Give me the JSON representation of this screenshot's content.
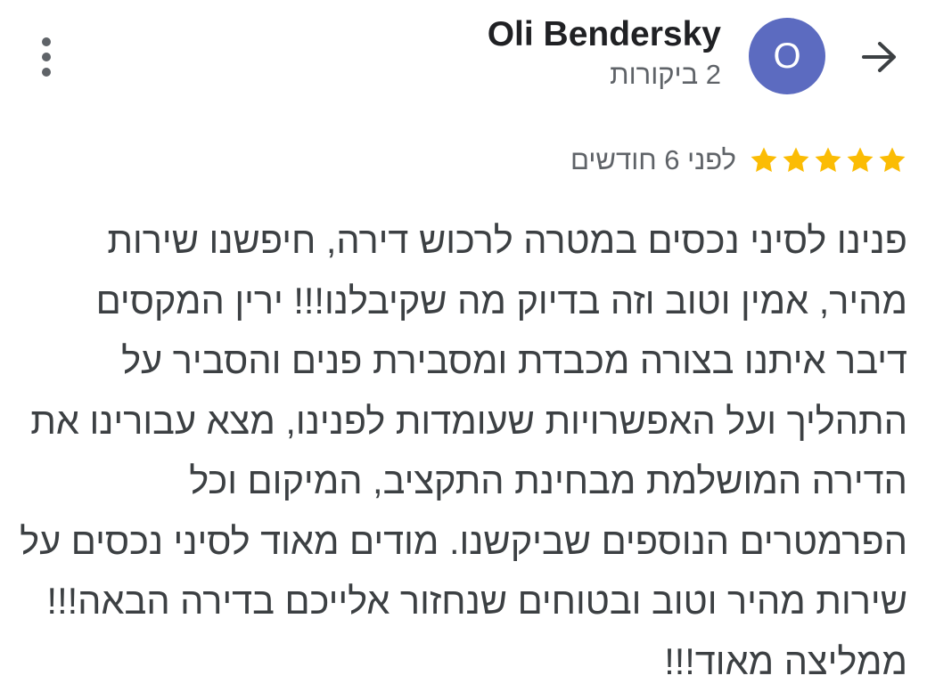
{
  "header": {
    "back_icon": "arrow-forward-icon",
    "avatar_letter": "O",
    "avatar_color": "#5c6bc0",
    "reviewer_name": "Oli Bendersky",
    "review_count": "2 ביקורות",
    "more_icon": "more-vert-icon"
  },
  "rating": {
    "stars": 5,
    "star_color": "#fbbc04",
    "time": "לפני 6 חודשים"
  },
  "review": {
    "text": "פנינו לסיני נכסים במטרה לרכוש דירה, חיפשנו שירות מהיר, אמין וטוב וזה בדיוק מה שקיבלנו!!! ירין המקסים דיבר איתנו בצורה מכבדת ומסבירת פנים והסביר על התהליך ועל האפשרויות שעומדות לפנינו, מצא עבורינו את הדירה המושלמת מבחינת התקציב, המיקום וכל הפרמטרים הנוספים שביקשנו. מודים מאוד לסיני נכסים על שירות מהיר וטוב ובטוחים שנחזור אלייכם בדירה הבאה!!! ממליצה מאוד!!!"
  }
}
